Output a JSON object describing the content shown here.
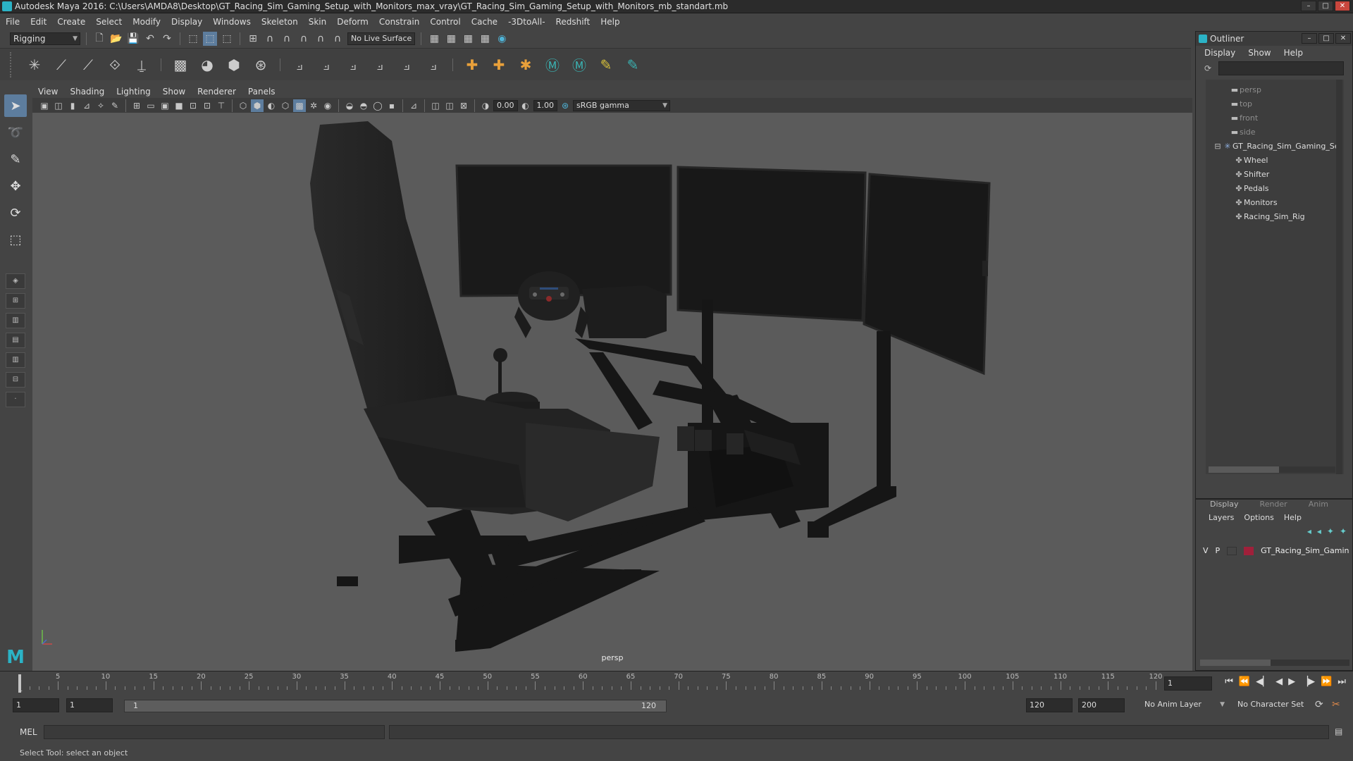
{
  "window": {
    "title": "Autodesk Maya 2016: C:\\Users\\AMDA8\\Desktop\\GT_Racing_Sim_Gaming_Setup_with_Monitors_max_vray\\GT_Racing_Sim_Gaming_Setup_with_Monitors_mb_standart.mb"
  },
  "menubar": [
    "File",
    "Edit",
    "Create",
    "Select",
    "Modify",
    "Display",
    "Windows",
    "Skeleton",
    "Skin",
    "Deform",
    "Constrain",
    "Control",
    "Cache",
    "-3DtoAll-",
    "Redshift",
    "Help"
  ],
  "statusline": {
    "mode": "Rigging",
    "live_surface": "No Live Surface"
  },
  "panel": {
    "menu": [
      "View",
      "Shading",
      "Lighting",
      "Show",
      "Renderer",
      "Panels"
    ],
    "exposure": "0.00",
    "gamma": "1.00",
    "colorspace": "sRGB gamma",
    "camera": "persp"
  },
  "outliner": {
    "title": "Outliner",
    "menu": [
      "Display",
      "Show",
      "Help"
    ],
    "cameras": [
      "persp",
      "top",
      "front",
      "side"
    ],
    "root": "GT_Racing_Sim_Gaming_Se",
    "children": [
      "Wheel",
      "Shifter",
      "Pedals",
      "Monitors",
      "Racing_Sim_Rig"
    ]
  },
  "layer_editor": {
    "tabs": [
      "Display",
      "Render",
      "Anim"
    ],
    "menu": [
      "Layers",
      "Options",
      "Help"
    ],
    "layer": {
      "v": "V",
      "p": "P",
      "name": "GT_Racing_Sim_Gamin",
      "color": "#a0203a"
    }
  },
  "timeline": {
    "ticks": [
      5,
      10,
      15,
      20,
      25,
      30,
      35,
      40,
      45,
      50,
      55,
      60,
      65,
      70,
      75,
      80,
      85,
      90,
      95,
      100,
      105,
      110,
      115,
      120
    ],
    "minor_label": "1",
    "current_frame": "1",
    "min": 1,
    "max": 120
  },
  "range": {
    "start": "1",
    "playback_start": "1",
    "slider_start": "1",
    "slider_end": "120",
    "playback_end": "120",
    "end": "200",
    "anim_layer": "No Anim Layer",
    "character_set": "No Character Set"
  },
  "command": {
    "lang": "MEL"
  },
  "status": {
    "help": "Select Tool: select an object"
  }
}
